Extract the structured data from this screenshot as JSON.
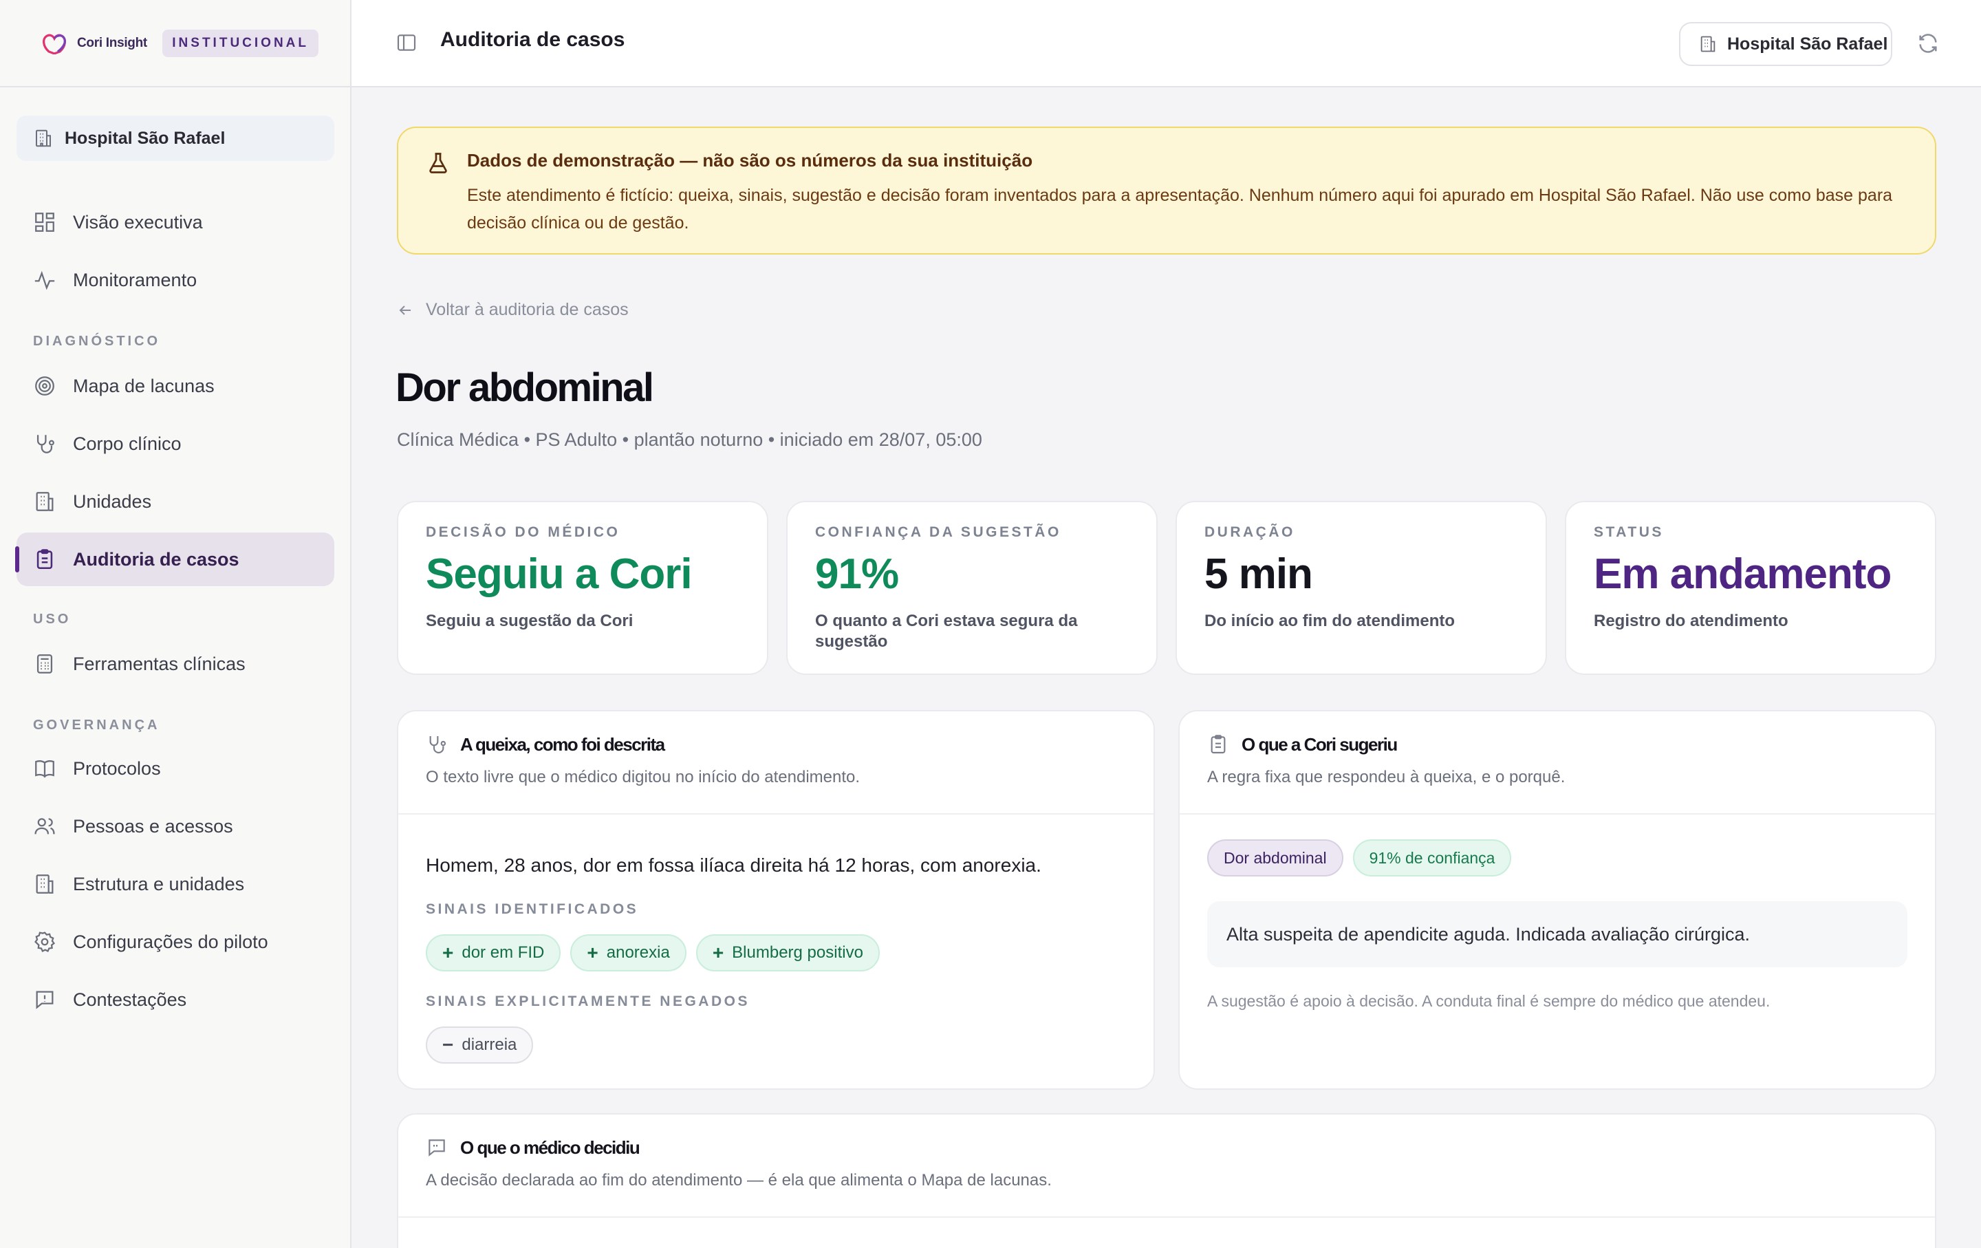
{
  "sidebar": {
    "brand": "Cori Insight",
    "badge": "INSTITUCIONAL",
    "hospital": "Hospital São Rafael",
    "items": {
      "visao": "Visão executiva",
      "monitoramento": "Monitoramento",
      "mapa": "Mapa de lacunas",
      "corpo": "Corpo clínico",
      "unidades": "Unidades",
      "auditoria": "Auditoria de casos",
      "ferramentas": "Ferramentas clínicas",
      "protocolos": "Protocolos",
      "pessoas": "Pessoas e acessos",
      "estrutura": "Estrutura e unidades",
      "config": "Configurações do piloto",
      "contestacoes": "Contestações"
    },
    "sections": {
      "diagnostico": "DIAGNÓSTICO",
      "uso": "USO",
      "governanca": "GOVERNANÇA"
    }
  },
  "topbar": {
    "title": "Auditoria de casos",
    "hospital": "Hospital São Rafael"
  },
  "banner": {
    "title": "Dados de demonstração — não são os números da sua instituição",
    "text": "Este atendimento é fictício: queixa, sinais, sugestão e decisão foram inventados para a apresentação. Nenhum número aqui foi apurado em Hospital São Rafael. Não use como base para decisão clínica ou de gestão."
  },
  "back_link": "Voltar à auditoria de casos",
  "case": {
    "title": "Dor abdominal",
    "subtitle": "Clínica Médica • PS Adulto • plantão noturno • iniciado em 28/07, 05:00"
  },
  "stats": [
    {
      "label": "DECISÃO DO MÉDICO",
      "value": "Seguiu a Cori",
      "desc": "Seguiu a sugestão da Cori",
      "color": "#0f8a5a"
    },
    {
      "label": "CONFIANÇA DA SUGESTÃO",
      "value": "91%",
      "desc": "O quanto a Cori estava segura da sugestão",
      "color": "#0f8a5a"
    },
    {
      "label": "DURAÇÃO",
      "value": "5 min",
      "desc": "Do início ao fim do atendimento",
      "color": "#15151e"
    },
    {
      "label": "STATUS",
      "value": "Em andamento",
      "desc": "Registro do atendimento",
      "color": "#4f2584"
    }
  ],
  "complaint": {
    "title": "A queixa, como foi descrita",
    "subtitle": "O texto livre que o médico digitou no início do atendimento.",
    "text": "Homem, 28 anos, dor em fossa ilíaca direita há 12 horas, com anorexia.",
    "identified_label": "SINAIS IDENTIFICADOS",
    "identified": [
      "dor em FID",
      "anorexia",
      "Blumberg positivo"
    ],
    "negated_label": "SINAIS EXPLICITAMENTE NEGADOS",
    "negated": [
      "diarreia"
    ]
  },
  "suggestion": {
    "title": "O que a Cori sugeriu",
    "subtitle": "A regra fixa que respondeu à queixa, e o porquê.",
    "tag_topic": "Dor abdominal",
    "tag_confidence": "91% de confiança",
    "text": "Alta suspeita de apendicite aguda. Indicada avaliação cirúrgica.",
    "note": "A sugestão é apoio à decisão. A conduta final é sempre do médico que atendeu."
  },
  "decision": {
    "title": "O que o médico decidiu",
    "subtitle": "A decisão declarada ao fim do atendimento — é ela que alimenta o Mapa de lacunas."
  }
}
